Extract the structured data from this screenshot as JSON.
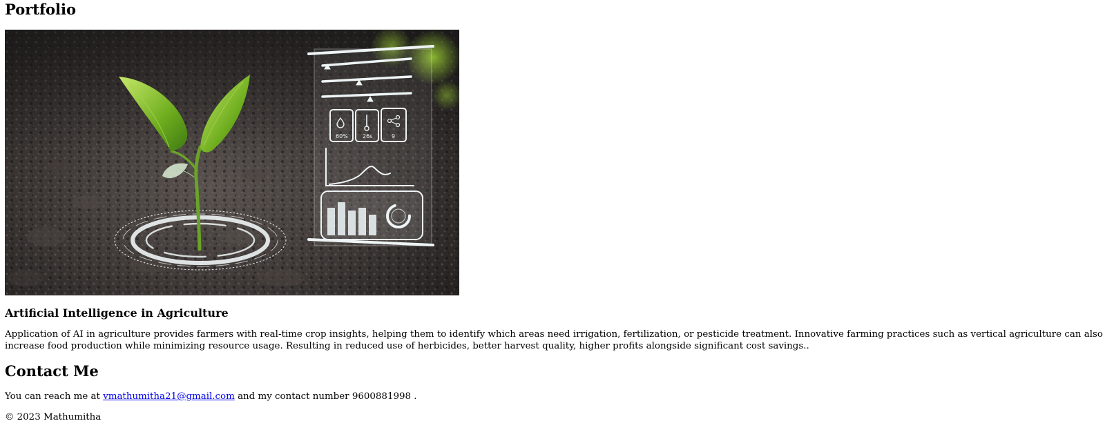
{
  "header": {
    "title": "Portfolio"
  },
  "project": {
    "image_alt": "Seedling sprouting in soil with holographic agriculture data panel",
    "hud_readouts": [
      "60%",
      "26s",
      "9"
    ],
    "title": "Artificial Intelligence in Agriculture",
    "description": "Application of AI in agriculture provides farmers with real-time crop insights, helping them to identify which areas need irrigation, fertilization, or pesticide treatment. Innovative farming practices such as vertical agriculture can also increase food production while minimizing resource usage. Resulting in reduced use of herbicides, better harvest quality, higher profits alongside significant cost savings.."
  },
  "contact": {
    "title": "Contact Me",
    "prefix": "You can reach me at",
    "email": "vmathumitha21@gmail.com",
    "email_href": "mailto:vmathumitha21@gmail.com",
    "middle": "and my contact number",
    "phone": "9600881998",
    "suffix": "."
  },
  "footer": {
    "text": "© 2023 Mathumitha"
  },
  "colors": {
    "link": "#0000ee",
    "soil_dark": "#2b2826",
    "leaf": "#7fbf2a",
    "hud": "#e8f0f2"
  }
}
